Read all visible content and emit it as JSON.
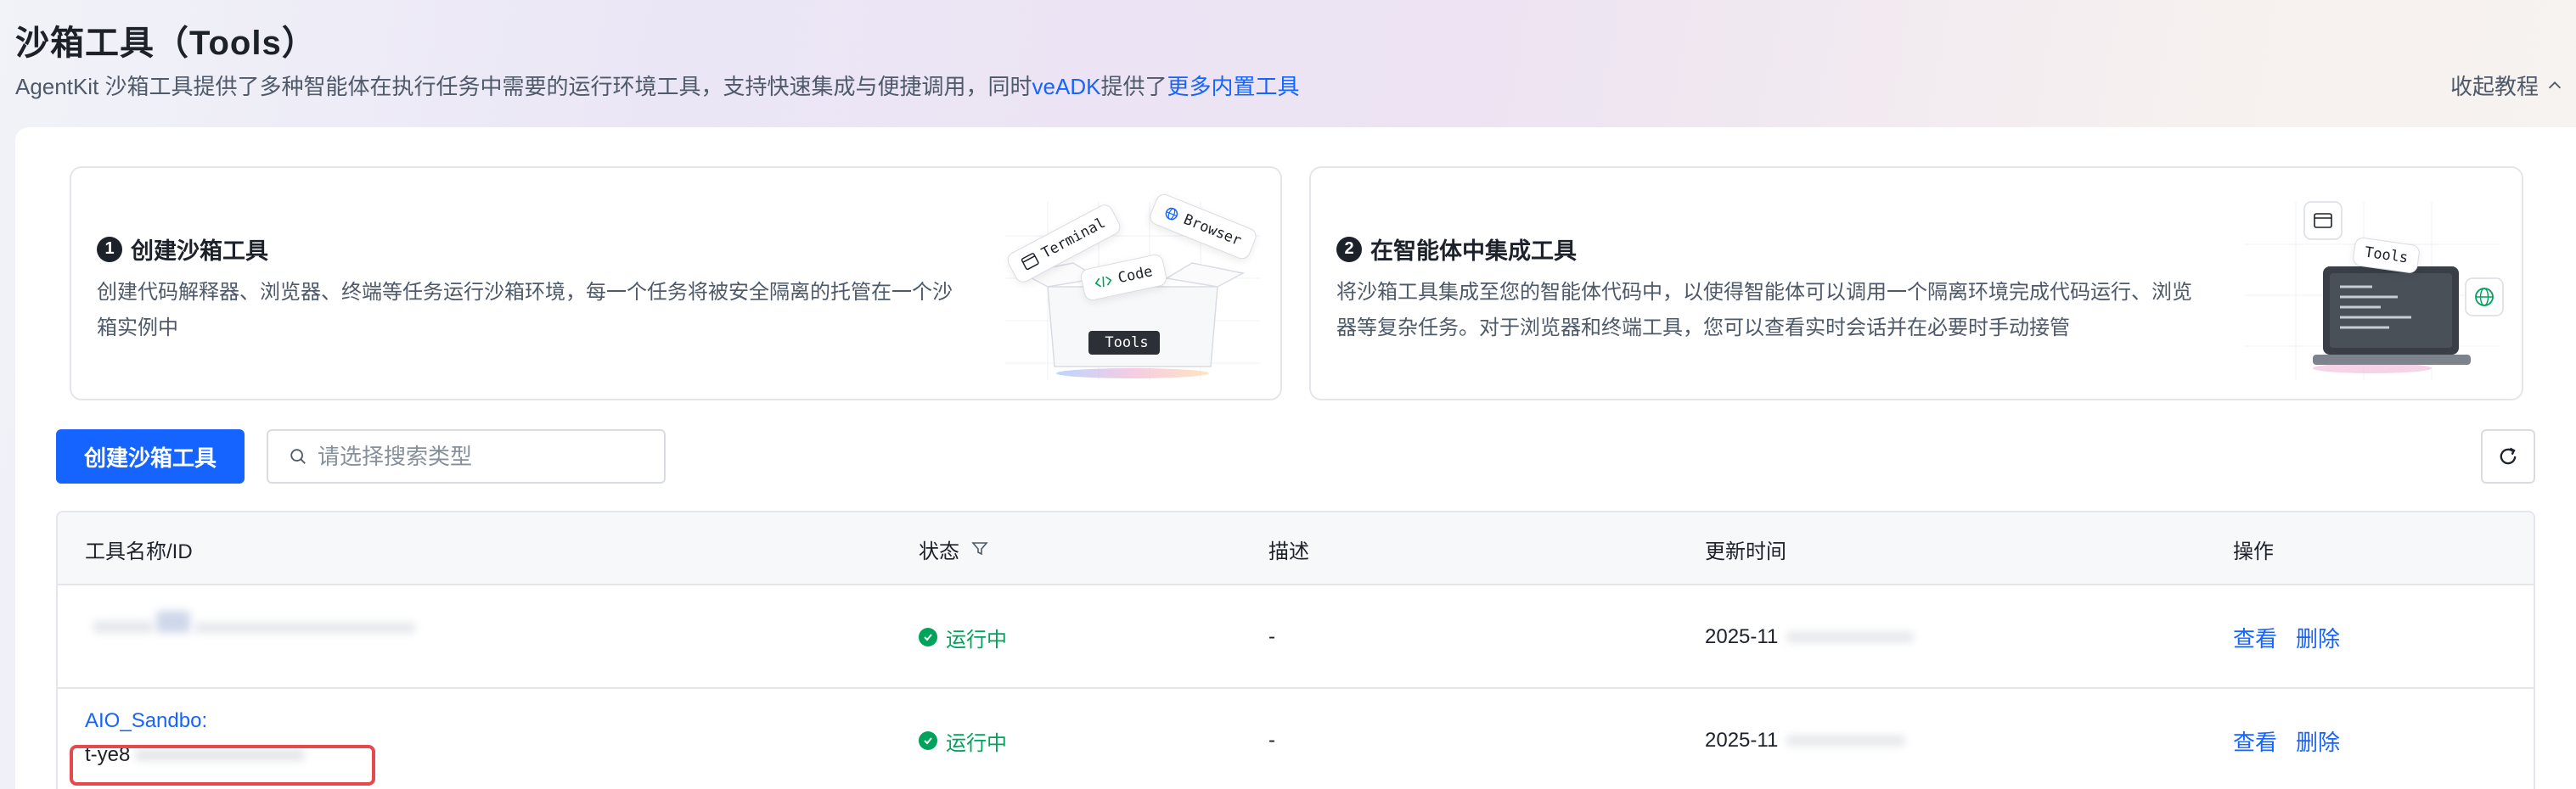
{
  "header": {
    "title": "沙箱工具（Tools）",
    "subtitle_prefix": "AgentKit 沙箱工具提供了多种智能体在执行任务中需要的运行环境工具，支持快速集成与便捷调用，同时",
    "subtitle_link1": "veADK",
    "subtitle_mid": "提供了",
    "subtitle_link2": "更多内置工具",
    "collapse_label": "收起教程"
  },
  "guides": [
    {
      "step": "1",
      "title": "创建沙箱工具",
      "desc": "创建代码解释器、浏览器、终端等任务运行沙箱环境，每一个任务将被安全隔离的托管在一个沙箱实例中",
      "tags": {
        "terminal": "Terminal",
        "browser": "Browser",
        "code": "Code",
        "box": "Tools"
      }
    },
    {
      "step": "2",
      "title": "在智能体中集成工具",
      "desc": "将沙箱工具集成至您的智能体代码中，以使得智能体可以调用一个隔离环境完成代码运行、浏览器等复杂任务。对于浏览器和终端工具，您可以查看实时会话并在必要时手动接管",
      "tags": {
        "tools": "Tools"
      }
    }
  ],
  "toolbar": {
    "create_label": "创建沙箱工具",
    "search_placeholder": "请选择搜索类型"
  },
  "table": {
    "columns": {
      "name": "工具名称/ID",
      "status": "状态",
      "desc": "描述",
      "time": "更新时间",
      "ops": "操作"
    },
    "rows": [
      {
        "name": "",
        "id": "",
        "status": "运行中",
        "desc": "-",
        "time": "2025-11",
        "view": "查看",
        "delete": "删除"
      },
      {
        "name": "AIO_Sandbo:",
        "id": "t-ye8",
        "status": "运行中",
        "desc": "-",
        "time": "2025-11",
        "view": "查看",
        "delete": "删除"
      }
    ]
  },
  "colors": {
    "primary": "#1664ff",
    "success": "#00a35c",
    "highlight": "#e5484d"
  }
}
